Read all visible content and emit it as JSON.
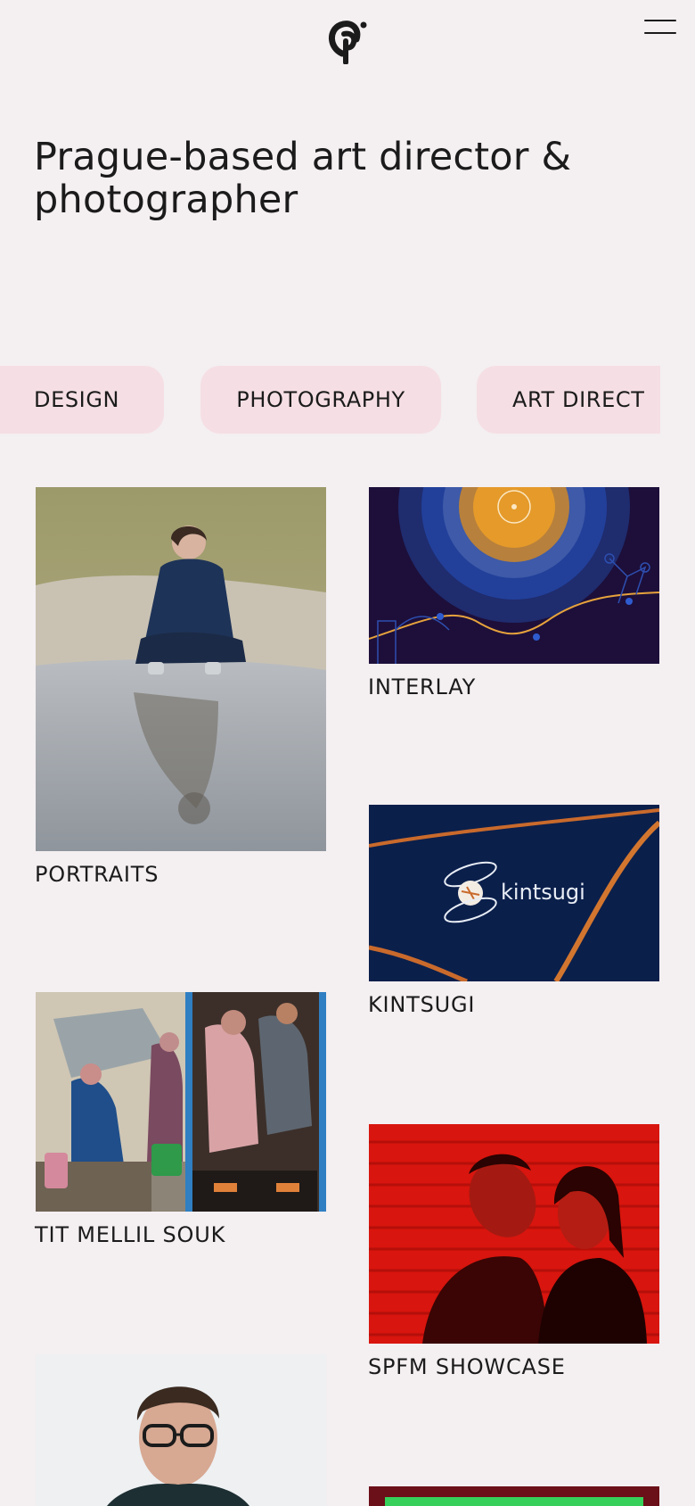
{
  "header": {
    "logo_icon": "cp-monogram-logo-icon",
    "menu_icon": "hamburger-menu-icon"
  },
  "headline": "Prague-based art director & photographer",
  "tabs": [
    "DESIGN",
    "PHOTOGRAPHY",
    "ART DIRECT"
  ],
  "projects": {
    "portraits": {
      "label": "PORTRAITS"
    },
    "interlay": {
      "label": "INTERLAY"
    },
    "kintsugi": {
      "label": "KINTSUGI",
      "logo_text": "kintsugi"
    },
    "souk": {
      "label": "TIT MELLIL SOUK"
    },
    "spfm": {
      "label": "SPFM SHOWCASE"
    }
  },
  "colors": {
    "background": "#f4eff1",
    "tab_background": "#f5dfe4",
    "text": "#1b1b1b"
  }
}
